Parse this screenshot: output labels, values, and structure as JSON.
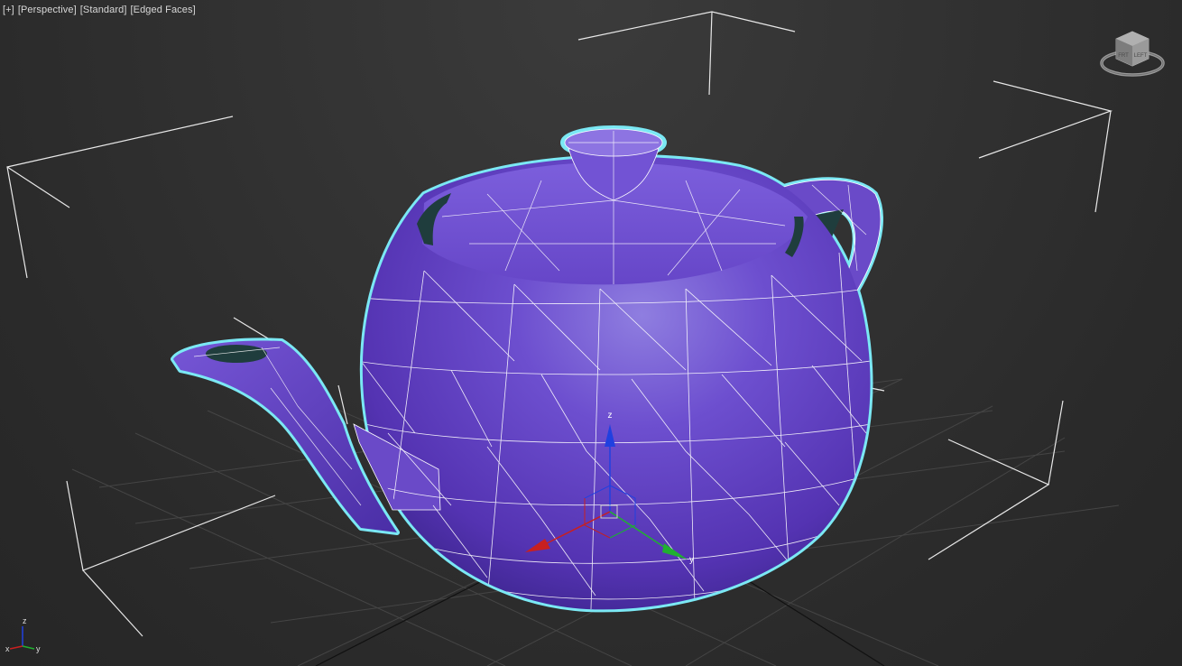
{
  "viewport": {
    "menu_label": "[+]",
    "view_label": "[Perspective]",
    "shading_label": "[Standard]",
    "edges_label": "[Edged Faces]"
  },
  "viewcube": {
    "face_label": "FRT",
    "side_label": "LEFT"
  },
  "gizmo": {
    "z_label": "z",
    "y_label": "y"
  },
  "axis_tripod": {
    "z_label": "z",
    "x_label": "x",
    "y_label": "y"
  },
  "colors": {
    "background": "#2b2b2b",
    "teapot_fill": "#6a4ac8",
    "selection_outline": "#7ff2ff",
    "wireframe": "#ffffff",
    "grid": "#4a4a4a",
    "axis_x": "#c82020",
    "axis_y": "#20b030",
    "axis_z": "#2040e0"
  }
}
